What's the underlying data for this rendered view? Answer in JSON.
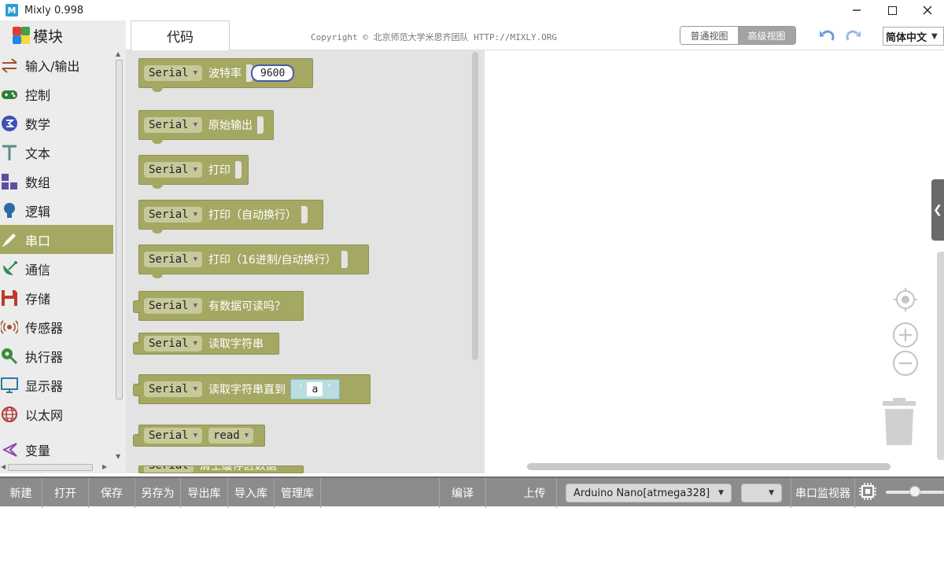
{
  "window": {
    "title": "Mixly 0.998",
    "icon_letter": "M"
  },
  "header": {
    "modules_label": "模块",
    "code_tab_label": "代码",
    "copyright": "Copyright © 北京师范大学米思齐团队 HTTP://MIXLY.ORG",
    "view_normal": "普通视图",
    "view_advanced": "高级视图",
    "language": "简体中文"
  },
  "sidebar": {
    "categories": [
      {
        "label": "输入/输出",
        "icon": "arrows-icon"
      },
      {
        "label": "控制",
        "icon": "gamepad-icon"
      },
      {
        "label": "数学",
        "icon": "math-icon"
      },
      {
        "label": "文本",
        "icon": "text-icon"
      },
      {
        "label": "数组",
        "icon": "array-icon"
      },
      {
        "label": "逻辑",
        "icon": "bulb-icon"
      },
      {
        "label": "串口",
        "icon": "pen-icon",
        "active": true
      },
      {
        "label": "通信",
        "icon": "satellite-icon"
      },
      {
        "label": "存储",
        "icon": "floppy-icon"
      },
      {
        "label": "传感器",
        "icon": "sensor-icon"
      },
      {
        "label": "执行器",
        "icon": "actuator-icon"
      },
      {
        "label": "显示器",
        "icon": "monitor-icon"
      },
      {
        "label": "以太网",
        "icon": "globe-icon"
      },
      {
        "label": "变量",
        "icon": "variable-icon"
      }
    ]
  },
  "blocks": [
    {
      "serial": "Serial",
      "label": "波特率",
      "value": "9600"
    },
    {
      "serial": "Serial",
      "label": "原始输出"
    },
    {
      "serial": "Serial",
      "label": "打印"
    },
    {
      "serial": "Serial",
      "label": "打印（自动换行）"
    },
    {
      "serial": "Serial",
      "label": "打印（16进制/自动换行）"
    },
    {
      "serial": "Serial",
      "label": "有数据可读吗？"
    },
    {
      "serial": "Serial",
      "label": "读取字符串"
    },
    {
      "serial": "Serial",
      "label": "读取字符串直到",
      "open_quote": "‘",
      "value": "a",
      "close_quote": "’"
    },
    {
      "serial": "Serial",
      "dropdown": "read"
    },
    {
      "serial": "Serial",
      "label": "清空缓存区数据"
    }
  ],
  "toolbar": {
    "new": "新建",
    "open": "打开",
    "save": "保存",
    "save_as": "另存为",
    "export_lib": "导出库",
    "import_lib": "导入库",
    "manage_lib": "管理库",
    "compile": "编译",
    "upload": "上传",
    "board": "Arduino Nano[atmega328]",
    "port": "",
    "serial_monitor": "串口监视器"
  },
  "colors": {
    "block": "#a5a863",
    "toolbar": "#8c8c8c",
    "sidebar": "#ececec",
    "flyout": "#e3e3e3"
  }
}
